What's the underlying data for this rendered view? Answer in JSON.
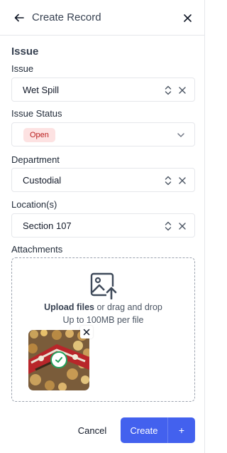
{
  "header": {
    "title": "Create Record",
    "back_icon": "arrow-left-icon",
    "close_icon": "close-icon"
  },
  "section": {
    "title": "Issue"
  },
  "fields": {
    "issue": {
      "label": "Issue",
      "value": "Wet Spill"
    },
    "issue_status": {
      "label": "Issue Status",
      "value": "Open"
    },
    "department": {
      "label": "Department",
      "value": "Custodial"
    },
    "locations": {
      "label": "Location(s)",
      "value": "Section 107"
    }
  },
  "attachments": {
    "label": "Attachments",
    "upload_link": "Upload files",
    "upload_rest": " or drag and drop",
    "limit": "Up to 100MB per file",
    "upload_icon": "image-upload-icon"
  },
  "actions": {
    "cancel": "Cancel",
    "create": "Create",
    "create_more": "+"
  },
  "colors": {
    "primary": "#4361ee",
    "status_open_bg": "#fde2e2",
    "status_open_text": "#b91c1c",
    "upload_success": "#22a05b"
  }
}
